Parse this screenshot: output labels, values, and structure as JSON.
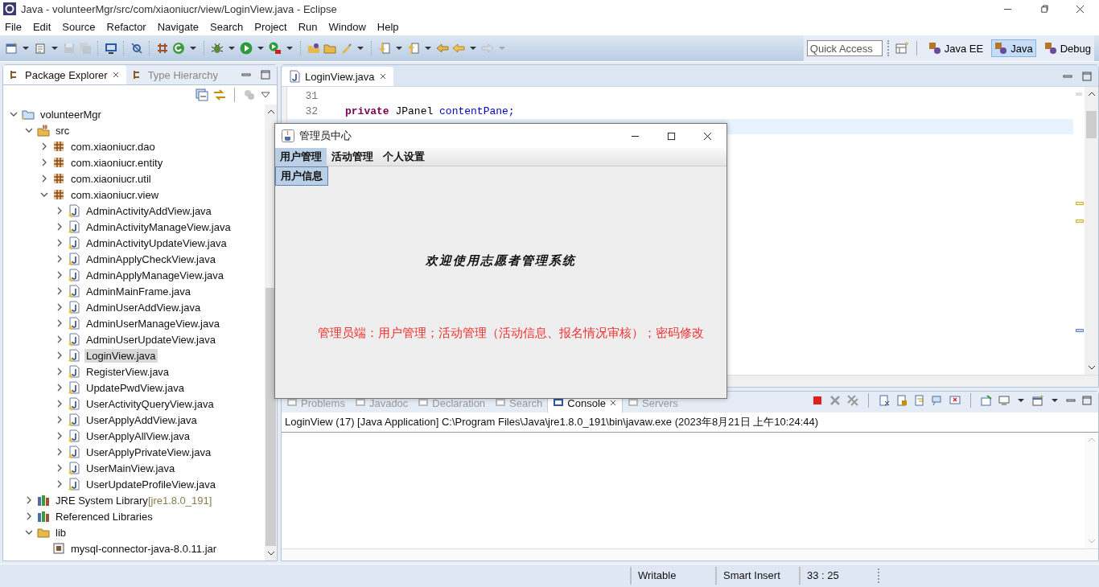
{
  "window": {
    "title": "Java - volunteerMgr/src/com/xiaoniucr/view/LoginView.java - Eclipse"
  },
  "menu": [
    "File",
    "Edit",
    "Source",
    "Refactor",
    "Navigate",
    "Search",
    "Project",
    "Run",
    "Window",
    "Help"
  ],
  "quick_access": {
    "placeholder": "Quick Access"
  },
  "perspectives": [
    {
      "label": "Java EE",
      "selected": false
    },
    {
      "label": "Java",
      "selected": true
    },
    {
      "label": "Debug",
      "selected": false
    }
  ],
  "left_tabs": [
    {
      "label": "Package Explorer",
      "selected": true
    },
    {
      "label": "Type Hierarchy",
      "selected": false
    }
  ],
  "tree": [
    {
      "kind": "project",
      "label": "volunteerMgr",
      "expanded": true,
      "selected": false,
      "children": [
        {
          "kind": "source",
          "label": "src",
          "expanded": true,
          "selected": false,
          "children": [
            {
              "kind": "package",
              "label": "com.xiaoniucr.dao",
              "expanded": false,
              "selected": false
            },
            {
              "kind": "package",
              "label": "com.xiaoniucr.entity",
              "expanded": false,
              "selected": false
            },
            {
              "kind": "package",
              "label": "com.xiaoniucr.util",
              "expanded": false,
              "selected": false
            },
            {
              "kind": "package",
              "label": "com.xiaoniucr.view",
              "expanded": true,
              "selected": false,
              "children": [
                {
                  "kind": "java",
                  "label": "AdminActivityAddView.java",
                  "expanded": false,
                  "selected": false
                },
                {
                  "kind": "java",
                  "label": "AdminActivityManageView.java",
                  "expanded": false,
                  "selected": false
                },
                {
                  "kind": "java",
                  "label": "AdminActivityUpdateView.java",
                  "expanded": false,
                  "selected": false
                },
                {
                  "kind": "java",
                  "label": "AdminApplyCheckView.java",
                  "expanded": false,
                  "selected": false
                },
                {
                  "kind": "java",
                  "label": "AdminApplyManageView.java",
                  "expanded": false,
                  "selected": false
                },
                {
                  "kind": "java",
                  "label": "AdminMainFrame.java",
                  "expanded": false,
                  "selected": false
                },
                {
                  "kind": "java",
                  "label": "AdminUserAddView.java",
                  "expanded": false,
                  "selected": false
                },
                {
                  "kind": "java",
                  "label": "AdminUserManageView.java",
                  "expanded": false,
                  "selected": false
                },
                {
                  "kind": "java",
                  "label": "AdminUserUpdateView.java",
                  "expanded": false,
                  "selected": false
                },
                {
                  "kind": "java",
                  "label": "LoginView.java",
                  "expanded": false,
                  "selected": true
                },
                {
                  "kind": "java",
                  "label": "RegisterView.java",
                  "expanded": false,
                  "selected": false
                },
                {
                  "kind": "java",
                  "label": "UpdatePwdView.java",
                  "expanded": false,
                  "selected": false
                },
                {
                  "kind": "java",
                  "label": "UserActivityQueryView.java",
                  "expanded": false,
                  "selected": false
                },
                {
                  "kind": "java",
                  "label": "UserApplyAddView.java",
                  "expanded": false,
                  "selected": false
                },
                {
                  "kind": "java",
                  "label": "UserApplyAllView.java",
                  "expanded": false,
                  "selected": false
                },
                {
                  "kind": "java",
                  "label": "UserApplyPrivateView.java",
                  "expanded": false,
                  "selected": false
                },
                {
                  "kind": "java",
                  "label": "UserMainView.java",
                  "expanded": false,
                  "selected": false
                },
                {
                  "kind": "java",
                  "label": "UserUpdateProfileView.java",
                  "expanded": false,
                  "selected": false
                }
              ]
            }
          ]
        },
        {
          "kind": "library",
          "label": "JRE System Library",
          "decoration": "[jre1.8.0_191]",
          "expanded": false,
          "selected": false
        },
        {
          "kind": "library",
          "label": "Referenced Libraries",
          "expanded": false,
          "selected": false
        },
        {
          "kind": "folder",
          "label": "lib",
          "expanded": true,
          "selected": false,
          "children": [
            {
              "kind": "jar",
              "label": "mysql-connector-java-8.0.11.jar",
              "selected": false
            }
          ]
        }
      ]
    }
  ],
  "editor": {
    "tab": "LoginView.java",
    "lines": [
      {
        "number": "31"
      },
      {
        "number": "32",
        "tokens": [
          {
            "kind": "keyword",
            "text": "private"
          },
          {
            "kind": "plain",
            "text": "JPanel"
          },
          {
            "kind": "field",
            "text": "contentPane;"
          }
        ]
      }
    ]
  },
  "console": {
    "tabs": [
      {
        "label": "Problems",
        "selected": false
      },
      {
        "label": "Javadoc",
        "selected": false
      },
      {
        "label": "Declaration",
        "selected": false
      },
      {
        "label": "Search",
        "selected": false
      },
      {
        "label": "Console",
        "selected": true
      },
      {
        "label": "Servers",
        "selected": false
      }
    ],
    "description": "LoginView (17) [Java Application] C:\\Program Files\\Java\\jre1.8.0_191\\bin\\javaw.exe (2023年8月21日 上午10:24:44)"
  },
  "dialog": {
    "title": "管理员中心",
    "menus": [
      {
        "label": "用户管理",
        "selected": true
      },
      {
        "label": "活动管理",
        "selected": false
      },
      {
        "label": "个人设置",
        "selected": false
      }
    ],
    "dropdown": [
      "用户信息"
    ],
    "welcome": "欢迎使用志愿者管理系统"
  },
  "annotation": "管理员端：用户管理；活动管理（活动信息、报名情况审核）；密码修改",
  "status_bar": [
    "Writable",
    "Smart Insert",
    "33 : 25"
  ]
}
